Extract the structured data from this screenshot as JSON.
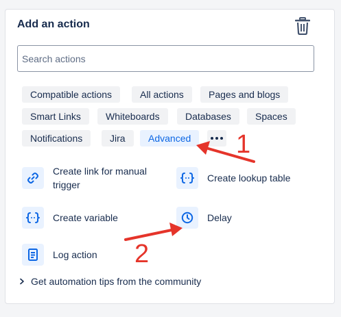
{
  "panel": {
    "title": "Add an action",
    "delete_icon": "trash-icon"
  },
  "search": {
    "placeholder": "Search actions",
    "value": ""
  },
  "filters": {
    "chips": [
      "Compatible actions",
      "All actions",
      "Pages and blogs",
      "Smart Links",
      "Whiteboards",
      "Databases",
      "Spaces",
      "Notifications",
      "Jira",
      "Advanced"
    ],
    "selected": "Advanced",
    "more_icon": "more-horizontal-icon"
  },
  "actions": [
    {
      "label": "Create link for manual trigger",
      "icon": "link-icon"
    },
    {
      "label": "Create lookup table",
      "icon": "braces-icon"
    },
    {
      "label": "Create variable",
      "icon": "braces-icon"
    },
    {
      "label": "Delay",
      "icon": "clock-icon"
    },
    {
      "label": "Log action",
      "icon": "document-icon"
    }
  ],
  "tips": {
    "label": "Get automation tips from the community",
    "icon": "chevron-right-icon"
  },
  "annotations": {
    "label_1": "1",
    "label_2": "2",
    "color": "#e5342a"
  },
  "colors": {
    "accent": "#0c66e4",
    "accent_bg": "#e9f2ff",
    "chip_bg": "#f1f2f4",
    "text": "#172b4d"
  }
}
